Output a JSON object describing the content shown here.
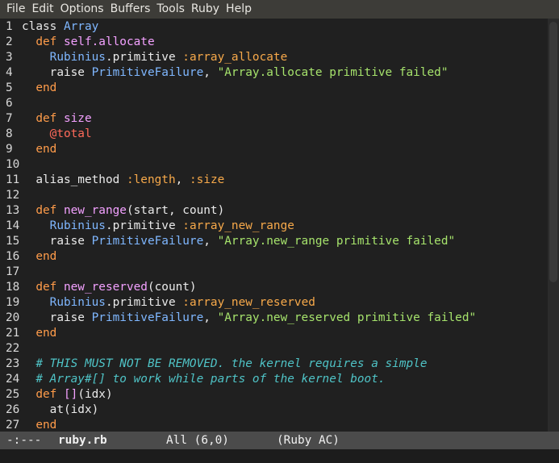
{
  "menubar": {
    "items": [
      "File",
      "Edit",
      "Options",
      "Buffers",
      "Tools",
      "Ruby",
      "Help"
    ]
  },
  "editor": {
    "lines": [
      {
        "n": "1",
        "tokens": [
          [
            "kw2",
            "class "
          ],
          [
            "const",
            "Array"
          ]
        ]
      },
      {
        "n": "2",
        "tokens": [
          [
            "plain",
            "  "
          ],
          [
            "kw",
            "def "
          ],
          [
            "def",
            "self.allocate"
          ]
        ]
      },
      {
        "n": "3",
        "tokens": [
          [
            "plain",
            "    "
          ],
          [
            "const",
            "Rubinius"
          ],
          [
            "plain",
            ".primitive "
          ],
          [
            "sym",
            ":array_allocate"
          ]
        ]
      },
      {
        "n": "4",
        "tokens": [
          [
            "plain",
            "    raise "
          ],
          [
            "const",
            "PrimitiveFailure"
          ],
          [
            "plain",
            ", "
          ],
          [
            "str",
            "\"Array.allocate primitive failed\""
          ]
        ]
      },
      {
        "n": "5",
        "tokens": [
          [
            "plain",
            "  "
          ],
          [
            "kw",
            "end"
          ]
        ]
      },
      {
        "n": "6",
        "tokens": []
      },
      {
        "n": "7",
        "tokens": [
          [
            "plain",
            "  "
          ],
          [
            "kw",
            "def "
          ],
          [
            "def",
            "size"
          ]
        ]
      },
      {
        "n": "8",
        "tokens": [
          [
            "plain",
            "    "
          ],
          [
            "ivar",
            "@total"
          ]
        ]
      },
      {
        "n": "9",
        "tokens": [
          [
            "plain",
            "  "
          ],
          [
            "kw",
            "end"
          ]
        ]
      },
      {
        "n": "10",
        "tokens": []
      },
      {
        "n": "11",
        "tokens": [
          [
            "plain",
            "  alias_method "
          ],
          [
            "sym",
            ":length"
          ],
          [
            "plain",
            ", "
          ],
          [
            "sym",
            ":size"
          ]
        ]
      },
      {
        "n": "12",
        "tokens": []
      },
      {
        "n": "13",
        "tokens": [
          [
            "plain",
            "  "
          ],
          [
            "kw",
            "def "
          ],
          [
            "def",
            "new_range"
          ],
          [
            "plain",
            "(start, count)"
          ]
        ]
      },
      {
        "n": "14",
        "tokens": [
          [
            "plain",
            "    "
          ],
          [
            "const",
            "Rubinius"
          ],
          [
            "plain",
            ".primitive "
          ],
          [
            "sym",
            ":array_new_range"
          ]
        ]
      },
      {
        "n": "15",
        "tokens": [
          [
            "plain",
            "    raise "
          ],
          [
            "const",
            "PrimitiveFailure"
          ],
          [
            "plain",
            ", "
          ],
          [
            "str",
            "\"Array.new_range primitive failed\""
          ]
        ]
      },
      {
        "n": "16",
        "tokens": [
          [
            "plain",
            "  "
          ],
          [
            "kw",
            "end"
          ]
        ]
      },
      {
        "n": "17",
        "tokens": []
      },
      {
        "n": "18",
        "tokens": [
          [
            "plain",
            "  "
          ],
          [
            "kw",
            "def "
          ],
          [
            "def",
            "new_reserved"
          ],
          [
            "plain",
            "(count)"
          ]
        ]
      },
      {
        "n": "19",
        "tokens": [
          [
            "plain",
            "    "
          ],
          [
            "const",
            "Rubinius"
          ],
          [
            "plain",
            ".primitive "
          ],
          [
            "sym",
            ":array_new_reserved"
          ]
        ]
      },
      {
        "n": "20",
        "tokens": [
          [
            "plain",
            "    raise "
          ],
          [
            "const",
            "PrimitiveFailure"
          ],
          [
            "plain",
            ", "
          ],
          [
            "str",
            "\"Array.new_reserved primitive failed\""
          ]
        ]
      },
      {
        "n": "21",
        "tokens": [
          [
            "plain",
            "  "
          ],
          [
            "kw",
            "end"
          ]
        ]
      },
      {
        "n": "22",
        "tokens": []
      },
      {
        "n": "23",
        "tokens": [
          [
            "plain",
            "  "
          ],
          [
            "cmt",
            "# THIS MUST NOT BE REMOVED. the kernel requires a simple"
          ]
        ]
      },
      {
        "n": "24",
        "tokens": [
          [
            "plain",
            "  "
          ],
          [
            "cmt",
            "# Array#[] to work while parts of the kernel boot."
          ]
        ]
      },
      {
        "n": "25",
        "tokens": [
          [
            "plain",
            "  "
          ],
          [
            "kw",
            "def "
          ],
          [
            "def",
            "[]"
          ],
          [
            "plain",
            "(idx)"
          ]
        ]
      },
      {
        "n": "26",
        "tokens": [
          [
            "plain",
            "    at(idx)"
          ]
        ]
      },
      {
        "n": "27",
        "tokens": [
          [
            "plain",
            "  "
          ],
          [
            "kw",
            "end"
          ]
        ]
      }
    ]
  },
  "modeline": {
    "status": "-:---",
    "buffer": "ruby.rb",
    "position": "All (6,0)",
    "mode": "(Ruby AC)"
  },
  "scrollbar": {
    "thumb_fraction": 0.64
  },
  "colors": {
    "keyword": "#ff9c4a",
    "definition": "#f3a1ff",
    "constant": "#7fb7ff",
    "symbol": "#f7a94a",
    "string": "#a6e36c",
    "instance_variable": "#ff6a5a",
    "comment": "#4fc3c6",
    "background": "#202020",
    "menubar": "#3d3c38",
    "modeline": "#4b4b4b"
  }
}
